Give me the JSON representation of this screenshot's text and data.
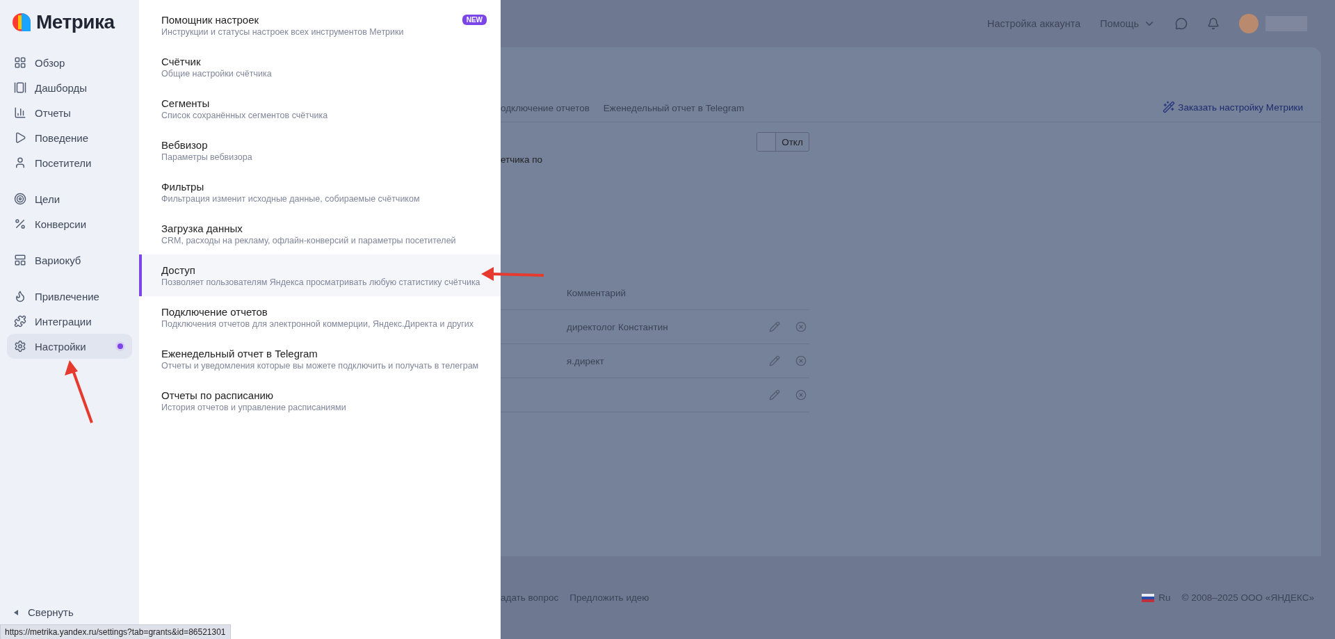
{
  "sidebar": {
    "logo": "Метрика",
    "groups": [
      [
        {
          "label": "Обзор",
          "selected": false,
          "notification": false
        },
        {
          "label": "Дашборды",
          "selected": false,
          "notification": false
        },
        {
          "label": "Отчеты",
          "selected": false,
          "notification": false
        },
        {
          "label": "Поведение",
          "selected": false,
          "notification": false
        },
        {
          "label": "Посетители",
          "selected": false,
          "notification": false
        }
      ],
      [
        {
          "label": "Цели",
          "selected": false,
          "notification": false
        },
        {
          "label": "Конверсии",
          "selected": false,
          "notification": false
        }
      ],
      [
        {
          "label": "Вариокуб",
          "selected": false,
          "notification": false
        }
      ],
      [
        {
          "label": "Привлечение",
          "selected": false,
          "notification": false
        },
        {
          "label": "Интеграции",
          "selected": false,
          "notification": false
        },
        {
          "label": "Настройки",
          "selected": true,
          "notification": true
        }
      ]
    ],
    "collapse": "Свернуть"
  },
  "settings_menu": [
    {
      "title": "Помощник настроек",
      "description": "Инструкции и статусы настроек всех инструментов Метрики",
      "badge": "NEW",
      "selected": false
    },
    {
      "title": "Счётчик",
      "description": "Общие настройки счётчика",
      "selected": false
    },
    {
      "title": "Сегменты",
      "description": "Список сохранённых сегментов счётчика",
      "selected": false
    },
    {
      "title": "Вебвизор",
      "description": "Параметры вебвизора",
      "selected": false
    },
    {
      "title": "Фильтры",
      "description": "Фильтрация изменит исходные данные, собираемые счётчиком",
      "selected": false
    },
    {
      "title": "Загрузка данных",
      "description": "CRM, расходы на рекламу, офлайн-конверсий и параметры посетителей",
      "selected": false
    },
    {
      "title": "Доступ",
      "description": "Позволяет пользователям Яндекса просматривать любую статистику счётчика",
      "selected": true
    },
    {
      "title": "Подключение отчетов",
      "description": "Подключения отчетов для электронной коммерции, Яндекс.Директа и других",
      "selected": false
    },
    {
      "title": "Еженедельный отчет в Telegram",
      "description": "Отчеты и уведомления которые вы можете подключить и получать в телеграм",
      "selected": false
    },
    {
      "title": "Отчеты по расписанию",
      "description": "История отчетов и управление расписаниями",
      "selected": false
    }
  ],
  "header": {
    "account_settings": "Настройка аккаунта",
    "help": "Помощь"
  },
  "tabs": [
    "одключение отчетов",
    "Еженедельный отчет в Telegram"
  ],
  "order_link": "Заказать настройку Метрики",
  "toggle": {
    "label": "Откл",
    "on": false
  },
  "description_fragment": "етчика по",
  "table": {
    "columns": [
      "Комментарий"
    ],
    "rows": [
      {
        "comment": "директолог Константин"
      },
      {
        "comment": "я.директ"
      },
      {}
    ]
  },
  "footer": {
    "links": [
      "адать вопрос",
      "Предложить идею"
    ],
    "language": "Ru",
    "copyright": "© 2008–2025 ООО «ЯНДЕКС»"
  },
  "status_url": "https://metrika.yandex.ru/settings?tab=grants&id=86521301"
}
